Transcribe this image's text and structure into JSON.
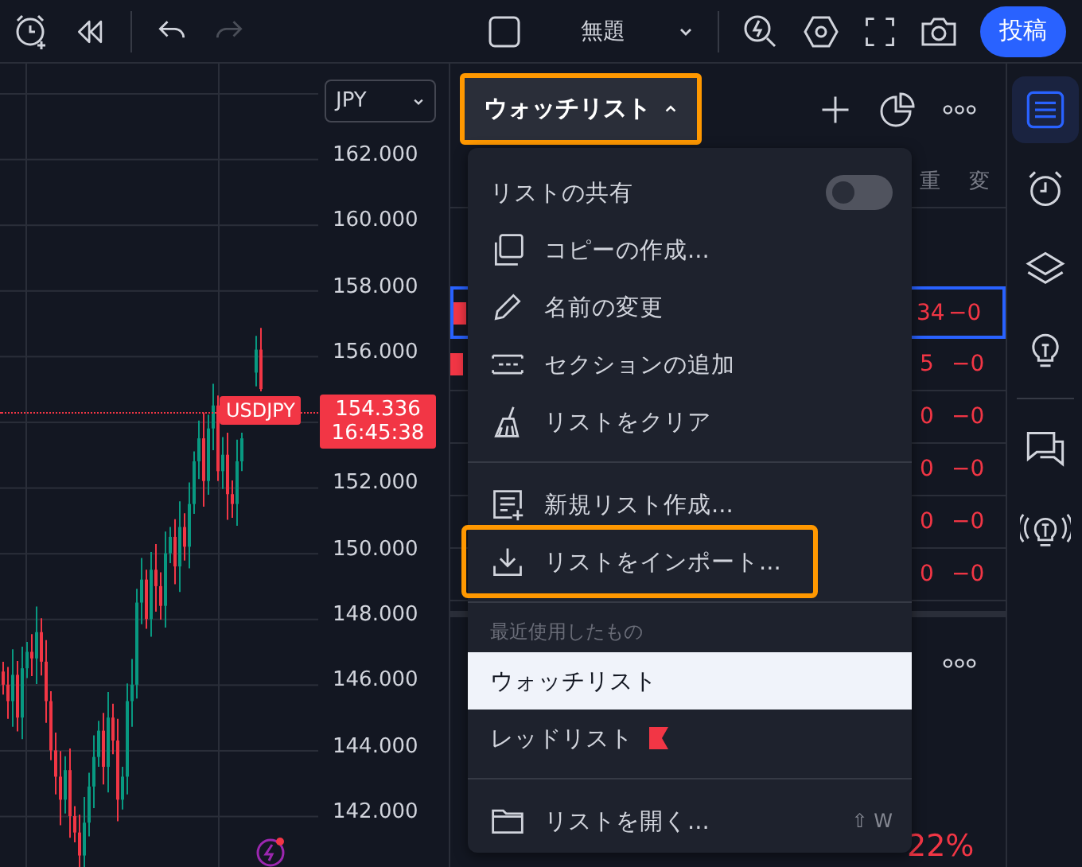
{
  "toolbar": {
    "title": "無題",
    "publish": "投稿",
    "redo_disabled": true
  },
  "chart": {
    "currency": "JPY",
    "price_labels": [
      "162.000",
      "160.000",
      "158.000",
      "156.000",
      "152.000",
      "150.000",
      "148.000",
      "146.000",
      "144.000",
      "142.000"
    ],
    "symbol_tag": "USDJPY",
    "last_price": "154.336",
    "countdown": "16:45:38"
  },
  "watchlist": {
    "title": "ウォッチリスト",
    "highlighted": true,
    "column_headers": [
      "重",
      "変"
    ],
    "rows": [
      {
        "value": "34",
        "change": "−0",
        "selected": true,
        "color": "#f23645"
      },
      {
        "value": "5",
        "change": "−0",
        "selected": false,
        "color": "#f23645"
      },
      {
        "value": "0",
        "change": "−0",
        "selected": false
      },
      {
        "value": "0",
        "change": "−0",
        "selected": false
      },
      {
        "value": "0",
        "change": "−0",
        "selected": false
      },
      {
        "value": "0",
        "change": "−0",
        "selected": false
      }
    ],
    "lower_percent": "22%"
  },
  "menu": {
    "share": {
      "label": "リストの共有",
      "on": false
    },
    "actions": [
      {
        "label": "コピーの作成...",
        "highlighted": false
      },
      {
        "label": "名前の変更",
        "highlighted": false
      },
      {
        "label": "セクションの追加",
        "highlighted": false
      },
      {
        "label": "リストをクリア",
        "highlighted": false
      }
    ],
    "actions2": [
      {
        "label": "新規リスト作成...",
        "highlighted": false
      },
      {
        "label": "リストをインポート...",
        "highlighted": true
      }
    ],
    "recent_heading": "最近使用したもの",
    "recent": [
      {
        "label": "ウォッチリスト",
        "selected": true
      },
      {
        "label": "レッドリスト",
        "selected": false,
        "color": "#f23645"
      }
    ],
    "open": {
      "label": "リストを開く...",
      "shortcut": "⇧ W"
    }
  },
  "sidebar": {
    "items": [
      {
        "selected": true
      },
      {
        "selected": false
      },
      {
        "selected": false
      },
      {
        "selected": false
      },
      {
        "selected": false
      },
      {
        "selected": false
      }
    ]
  }
}
